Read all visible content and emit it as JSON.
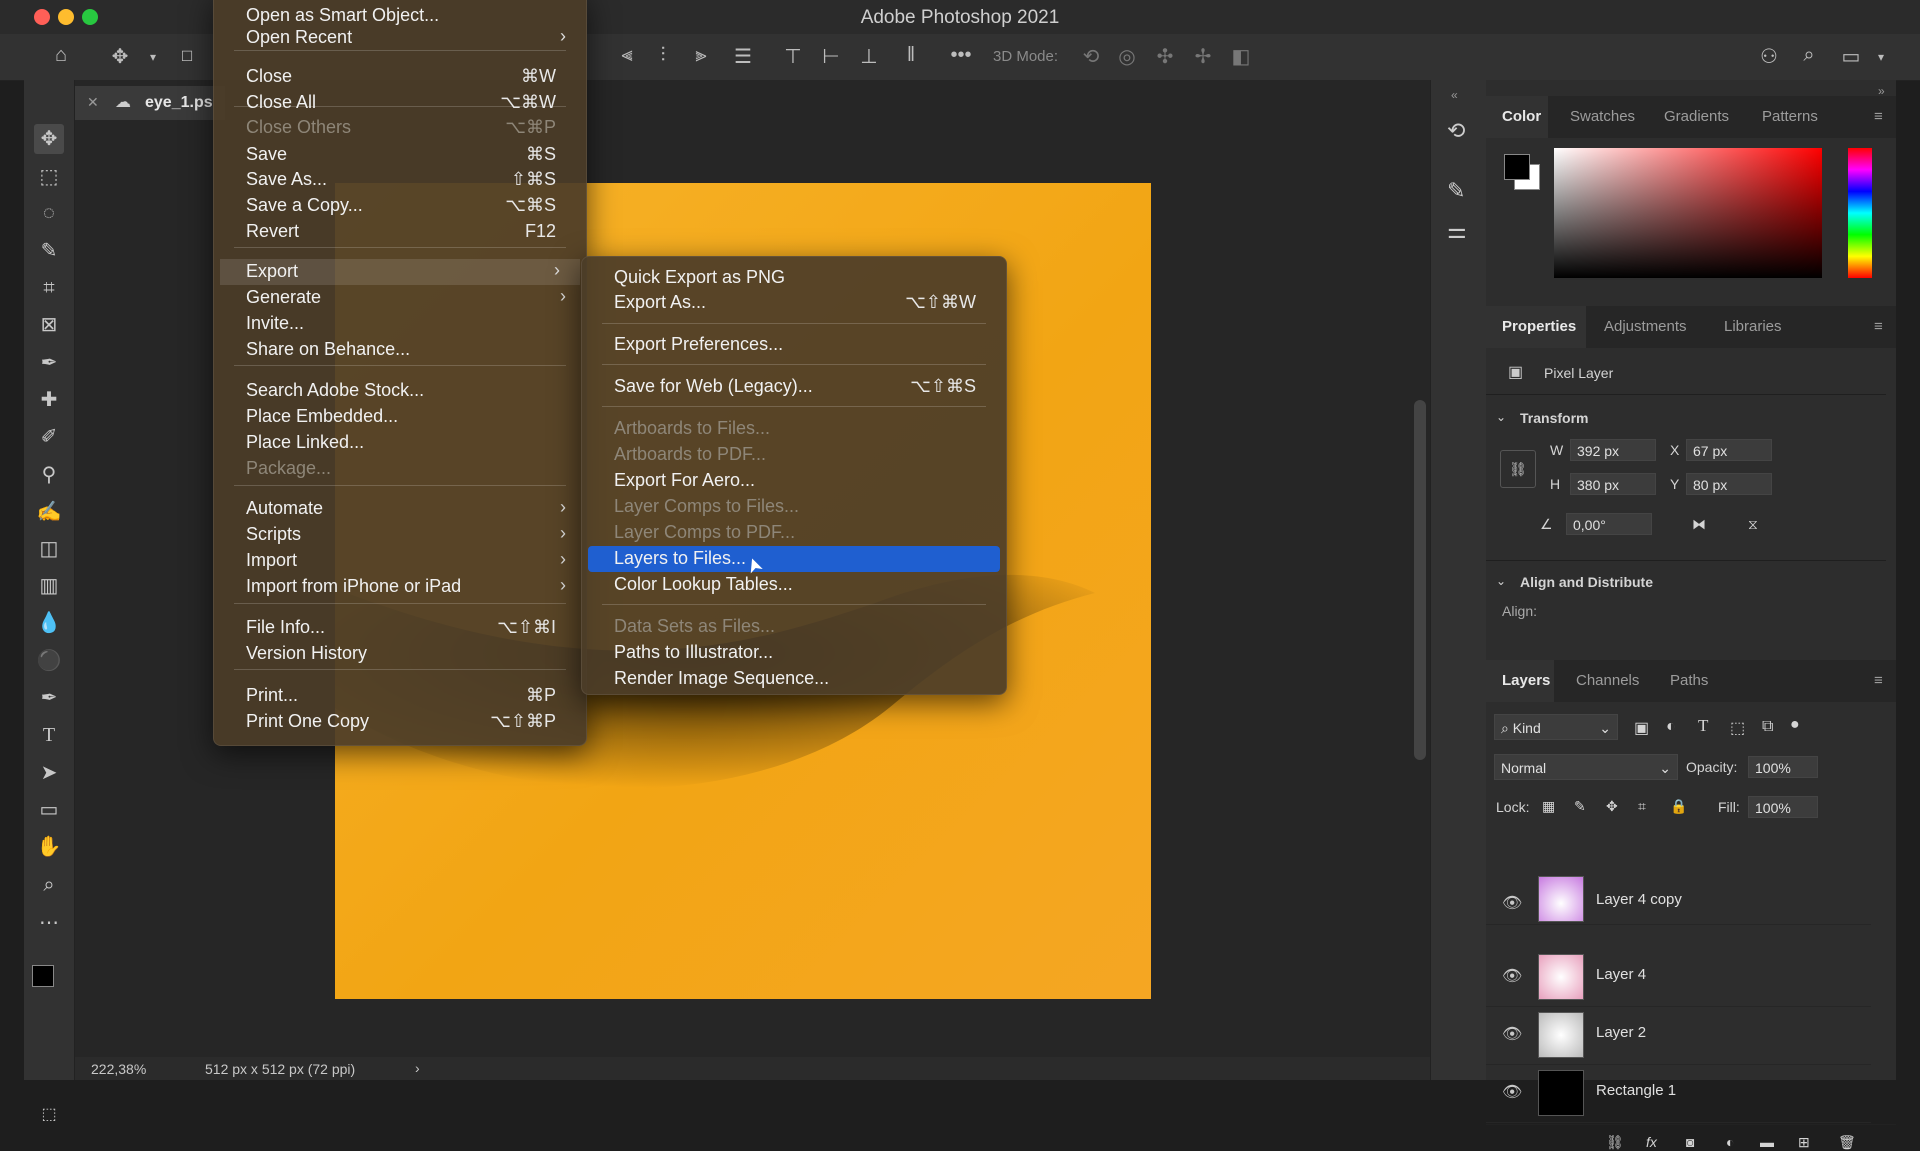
{
  "window": {
    "title": "Adobe Photoshop 2021"
  },
  "document": {
    "tab_label": "eye_1.ps",
    "zoom": "222,38%",
    "info": "512 px x 512 px (72 ppi)"
  },
  "options_bar": {
    "mode_3d": "3D Mode:"
  },
  "file_menu": {
    "items": [
      {
        "label": "Open as Smart Object...",
        "shortcut": "",
        "arrow": false,
        "disabled": false
      },
      {
        "label": "Open Recent",
        "shortcut": "",
        "arrow": true,
        "disabled": false
      },
      {
        "label": "Close",
        "shortcut": "⌘W",
        "arrow": false,
        "disabled": false
      },
      {
        "label": "Close All",
        "shortcut": "⌥⌘W",
        "arrow": false,
        "disabled": false
      },
      {
        "label": "Close Others",
        "shortcut": "⌥⌘P",
        "arrow": false,
        "disabled": true
      },
      {
        "label": "Save",
        "shortcut": "⌘S",
        "arrow": false,
        "disabled": false
      },
      {
        "label": "Save As...",
        "shortcut": "⇧⌘S",
        "arrow": false,
        "disabled": false
      },
      {
        "label": "Save a Copy...",
        "shortcut": "⌥⌘S",
        "arrow": false,
        "disabled": false
      },
      {
        "label": "Revert",
        "shortcut": "F12",
        "arrow": false,
        "disabled": false
      },
      {
        "label": "Export",
        "shortcut": "",
        "arrow": true,
        "disabled": false
      },
      {
        "label": "Generate",
        "shortcut": "",
        "arrow": true,
        "disabled": false
      },
      {
        "label": "Invite...",
        "shortcut": "",
        "arrow": false,
        "disabled": false
      },
      {
        "label": "Share on Behance...",
        "shortcut": "",
        "arrow": false,
        "disabled": false
      },
      {
        "label": "Search Adobe Stock...",
        "shortcut": "",
        "arrow": false,
        "disabled": false
      },
      {
        "label": "Place Embedded...",
        "shortcut": "",
        "arrow": false,
        "disabled": false
      },
      {
        "label": "Place Linked...",
        "shortcut": "",
        "arrow": false,
        "disabled": false
      },
      {
        "label": "Package...",
        "shortcut": "",
        "arrow": false,
        "disabled": true
      },
      {
        "label": "Automate",
        "shortcut": "",
        "arrow": true,
        "disabled": false
      },
      {
        "label": "Scripts",
        "shortcut": "",
        "arrow": true,
        "disabled": false
      },
      {
        "label": "Import",
        "shortcut": "",
        "arrow": true,
        "disabled": false
      },
      {
        "label": "Import from iPhone or iPad",
        "shortcut": "",
        "arrow": true,
        "disabled": false
      },
      {
        "label": "File Info...",
        "shortcut": "⌥⇧⌘I",
        "arrow": false,
        "disabled": false
      },
      {
        "label": "Version History",
        "shortcut": "",
        "arrow": false,
        "disabled": false
      },
      {
        "label": "Print...",
        "shortcut": "⌘P",
        "arrow": false,
        "disabled": false
      },
      {
        "label": "Print One Copy",
        "shortcut": "⌥⇧⌘P",
        "arrow": false,
        "disabled": false
      }
    ]
  },
  "export_menu": {
    "items": [
      {
        "label": "Quick Export as PNG",
        "shortcut": "",
        "disabled": false,
        "highlighted": false
      },
      {
        "label": "Export As...",
        "shortcut": "⌥⇧⌘W",
        "disabled": false,
        "highlighted": false
      },
      {
        "label": "Export Preferences...",
        "shortcut": "",
        "disabled": false,
        "highlighted": false
      },
      {
        "label": "Save for Web (Legacy)...",
        "shortcut": "⌥⇧⌘S",
        "disabled": false,
        "highlighted": false
      },
      {
        "label": "Artboards to Files...",
        "shortcut": "",
        "disabled": true,
        "highlighted": false
      },
      {
        "label": "Artboards to PDF...",
        "shortcut": "",
        "disabled": true,
        "highlighted": false
      },
      {
        "label": "Export For Aero...",
        "shortcut": "",
        "disabled": false,
        "highlighted": false
      },
      {
        "label": "Layer Comps to Files...",
        "shortcut": "",
        "disabled": true,
        "highlighted": false
      },
      {
        "label": "Layer Comps to PDF...",
        "shortcut": "",
        "disabled": true,
        "highlighted": false
      },
      {
        "label": "Layers to Files...",
        "shortcut": "",
        "disabled": false,
        "highlighted": true
      },
      {
        "label": "Color Lookup Tables...",
        "shortcut": "",
        "disabled": false,
        "highlighted": false
      },
      {
        "label": "Data Sets as Files...",
        "shortcut": "",
        "disabled": true,
        "highlighted": false
      },
      {
        "label": "Paths to Illustrator...",
        "shortcut": "",
        "disabled": false,
        "highlighted": false
      },
      {
        "label": "Render Image Sequence...",
        "shortcut": "",
        "disabled": false,
        "highlighted": false
      }
    ]
  },
  "color_panel": {
    "tabs": [
      "Color",
      "Swatches",
      "Gradients",
      "Patterns"
    ]
  },
  "properties_panel": {
    "tabs": [
      "Properties",
      "Adjustments",
      "Libraries"
    ],
    "layer_type": "Pixel Layer",
    "transform_label": "Transform",
    "w_label": "W",
    "w": "392 px",
    "x_label": "X",
    "x": "67 px",
    "h_label": "H",
    "h": "380 px",
    "y_label": "Y",
    "y": "80 px",
    "angle": "0,00°",
    "align_label": "Align and Distribute",
    "align_sub": "Align:"
  },
  "layers_panel": {
    "tabs": [
      "Layers",
      "Channels",
      "Paths"
    ],
    "filter": "Kind",
    "blend_mode": "Normal",
    "opacity_label": "Opacity:",
    "opacity": "100%",
    "lock_label": "Lock:",
    "fill_label": "Fill:",
    "fill": "100%",
    "layers": [
      "Layer 4 copy",
      "Layer 4",
      "Layer 2",
      "Rectangle 1"
    ]
  },
  "colors": {
    "accent": "#1f5fd0",
    "canvas": "#f5a623"
  }
}
